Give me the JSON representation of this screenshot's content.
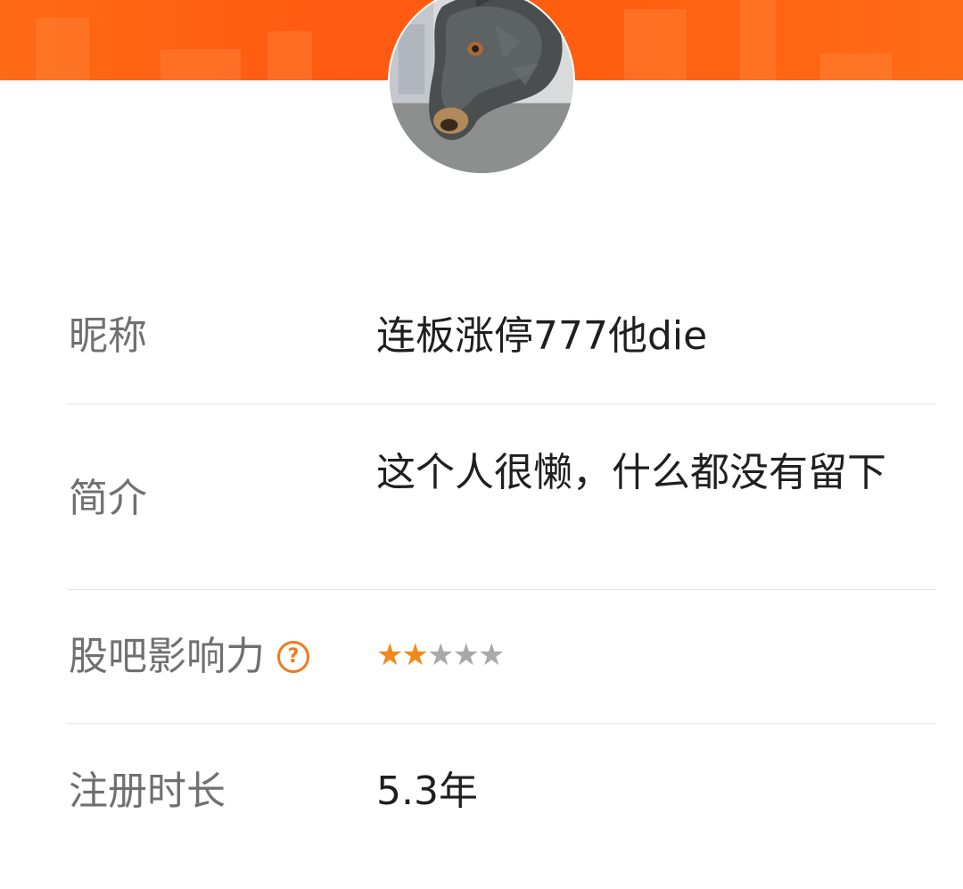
{
  "colors": {
    "banner": "#ff5f10",
    "label_text": "#707070",
    "value_text": "#1f1f1f",
    "accent": "#f07a1c",
    "star_on": "#f08a1c",
    "star_off": "#a9a9a9",
    "divider": "#e6e6e6"
  },
  "profile": {
    "avatar_icon": "avatar-bull-statue-photo",
    "rows": [
      {
        "label": "昵称",
        "value": "连板涨停777他die"
      },
      {
        "label": "简介",
        "value": "这个人很懒，什么都没有留下"
      },
      {
        "label": "股吧影响力",
        "help_icon": "question-circle-icon",
        "help_glyph": "?",
        "rating": 2,
        "rating_max": 5
      },
      {
        "label": "注册时长",
        "value": "5.3年"
      }
    ]
  }
}
